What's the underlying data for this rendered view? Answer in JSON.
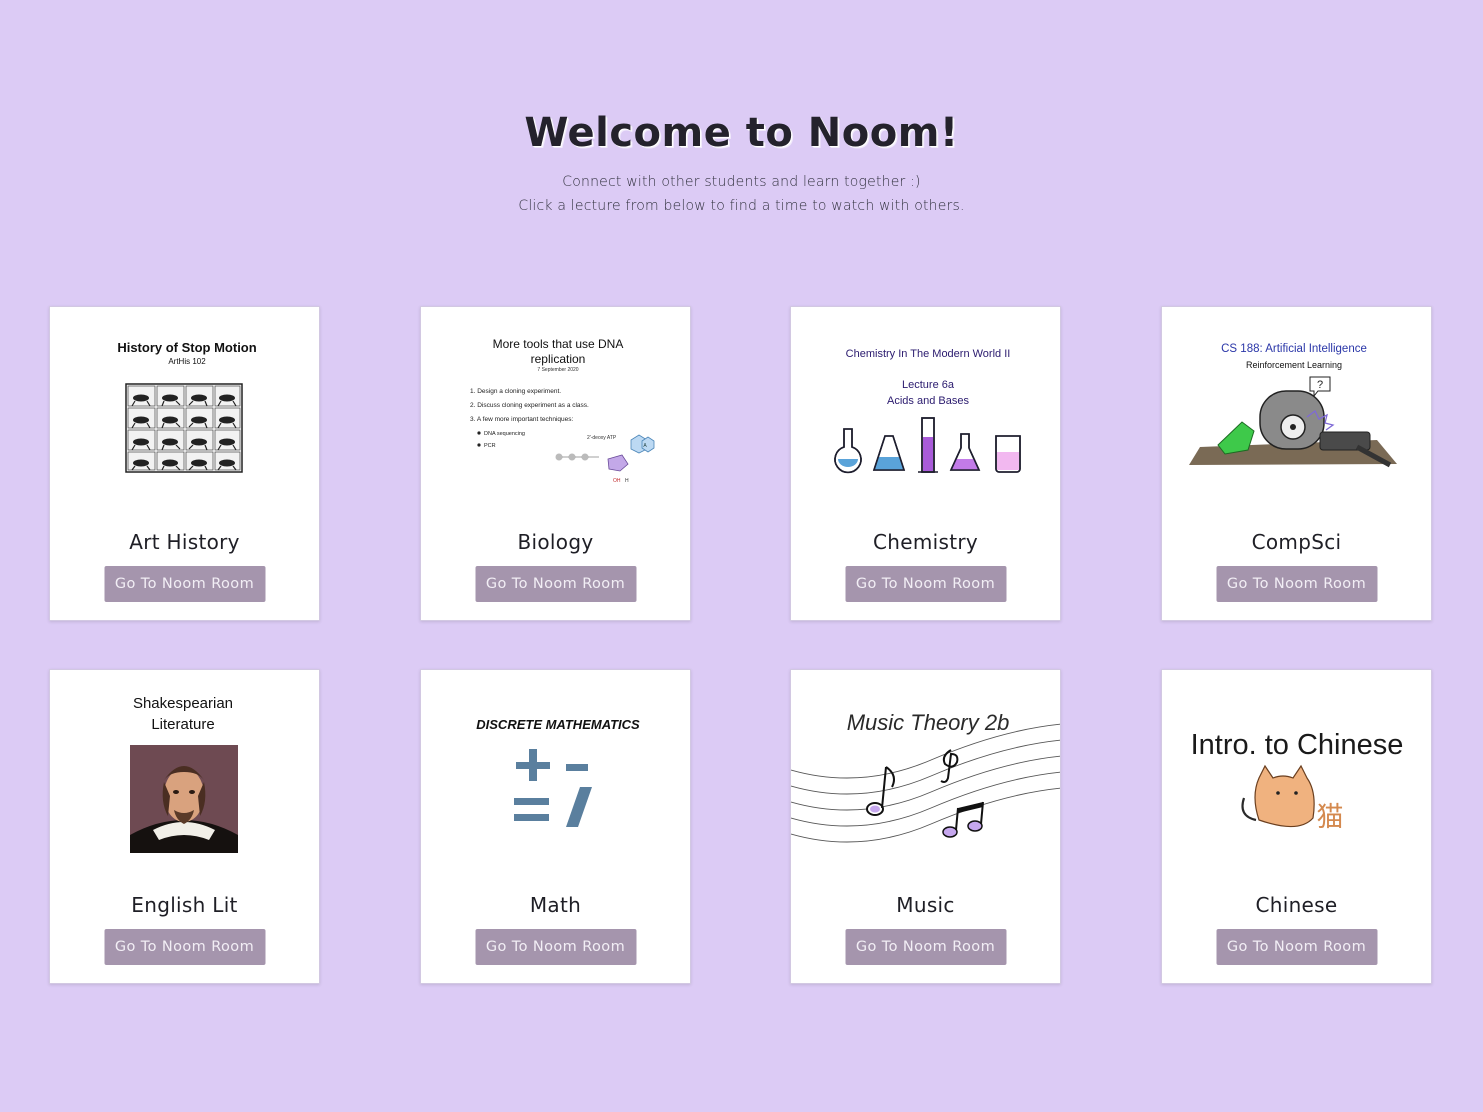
{
  "header": {
    "title": "Welcome to Noom!",
    "subtitle_line1": "Connect with other students and learn together :)",
    "subtitle_line2": "Click a lecture from below to find a time to watch with others."
  },
  "colors": {
    "background": "#dccbf5",
    "button": "#a595ad",
    "card": "#ffffff"
  },
  "courses": [
    {
      "name": "Art History",
      "button": "Go To Noom Room",
      "thumb": {
        "title": "History of Stop Motion",
        "subtitle": "ArtHis 102",
        "icon": "horse-motion-frames-icon"
      }
    },
    {
      "name": "Biology",
      "button": "Go To Noom Room",
      "thumb": {
        "title_line1": "More tools that use DNA",
        "title_line2": "replication",
        "date": "7 September 2020",
        "item1": "1. Design a cloning experiment.",
        "item2": "2. Discuss cloning experiment as a class.",
        "item3": "3. A few more important techniques:",
        "sub1": "DNA sequencing",
        "sub2": "PCR",
        "diagram_label": "2'-deoxy ATP",
        "oh_label": "OH",
        "h_label": "H",
        "icon": "nucleotide-diagram-icon"
      }
    },
    {
      "name": "Chemistry",
      "button": "Go To Noom Room",
      "thumb": {
        "title": "Chemistry In The Modern World II",
        "lecture": "Lecture 6a",
        "topic": "Acids and Bases",
        "icon": "lab-glassware-icon"
      }
    },
    {
      "name": "CompSci",
      "button": "Go To Noom Room",
      "thumb": {
        "title": "CS 188: Artificial Intelligence",
        "subtitle": "Reinforcement Learning",
        "question": "?",
        "icon": "robot-icon"
      }
    },
    {
      "name": "English Lit",
      "button": "Go To Noom Room",
      "thumb": {
        "title_line1": "Shakespearian",
        "title_line2": "Literature",
        "icon": "shakespeare-portrait-icon"
      }
    },
    {
      "name": "Math",
      "button": "Go To Noom Room",
      "thumb": {
        "title": "DISCRETE MATHEMATICS",
        "icon": "math-operators-icon"
      }
    },
    {
      "name": "Music",
      "button": "Go To Noom Room",
      "thumb": {
        "title": "Music Theory 2b",
        "icon": "music-notes-icon"
      }
    },
    {
      "name": "Chinese",
      "button": "Go To Noom Room",
      "thumb": {
        "title": "Intro. to Chinese",
        "character": "猫",
        "icon": "cat-icon"
      }
    }
  ]
}
